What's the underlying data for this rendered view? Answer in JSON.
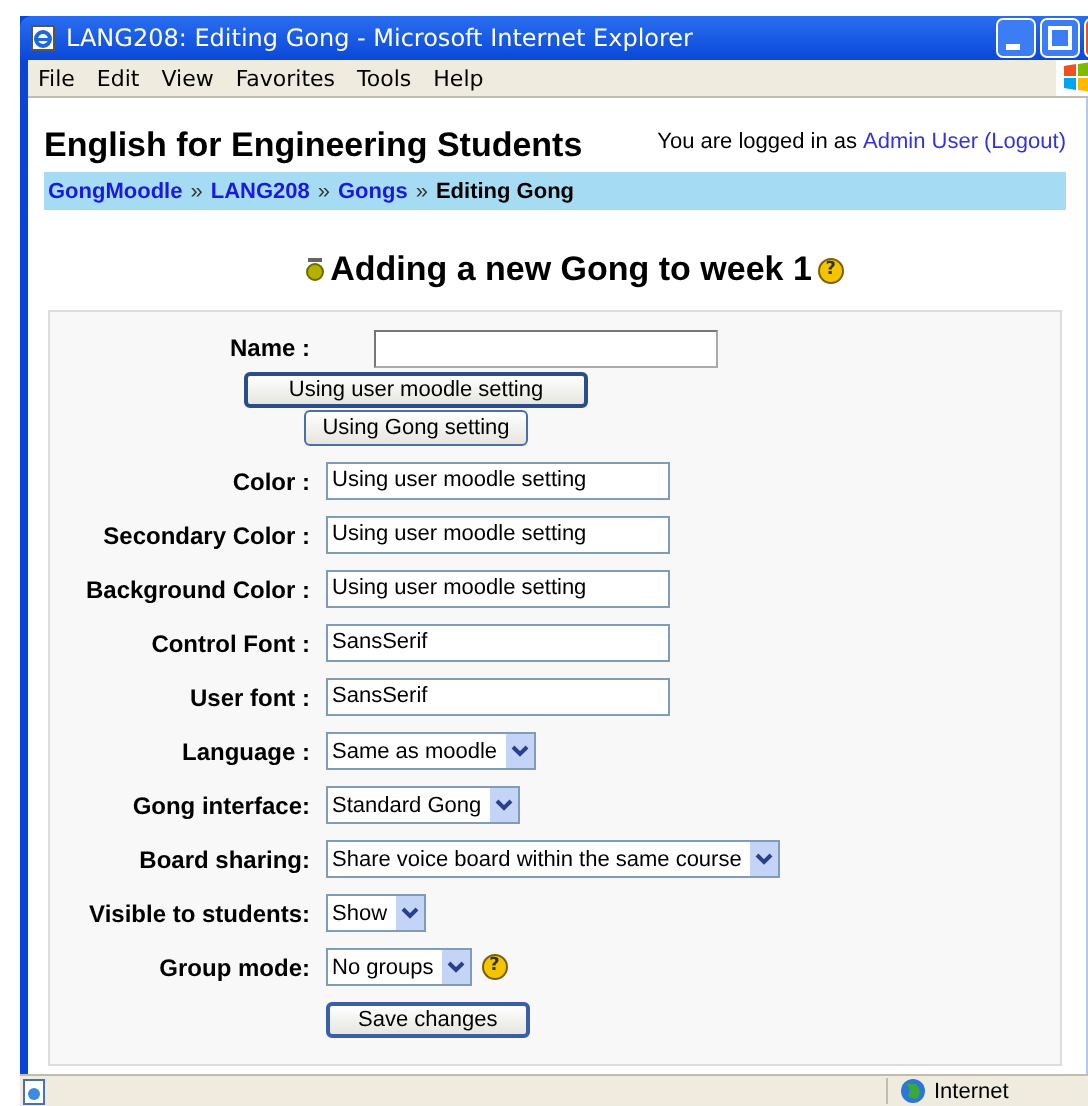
{
  "window": {
    "title": "LANG208: Editing Gong - Microsoft Internet Explorer"
  },
  "menu": [
    {
      "label": "File"
    },
    {
      "label": "Edit"
    },
    {
      "label": "View"
    },
    {
      "label": "Favorites"
    },
    {
      "label": "Tools"
    },
    {
      "label": "Help"
    }
  ],
  "header": {
    "site_title": "English for Engineering Students",
    "login_prefix": "You are logged in as",
    "user": "Admin User",
    "logout": "(Logout)"
  },
  "breadcrumb": {
    "separator": "»",
    "items": [
      {
        "label": "GongMoodle",
        "link": true
      },
      {
        "label": "LANG208",
        "link": true
      },
      {
        "label": "Gongs",
        "link": true
      },
      {
        "label": "Editing Gong",
        "link": false
      }
    ]
  },
  "heading": {
    "text": "Adding a new Gong to week 1",
    "help": "?"
  },
  "form": {
    "rows": [
      {
        "kind": "input",
        "label": "Name :"
      },
      {
        "kind": "buttons",
        "buttons": [
          {
            "label": "Using user moodle setting",
            "focused": true
          },
          {
            "label": "Using Gong setting",
            "focused": false
          }
        ]
      },
      {
        "kind": "text",
        "label": "Color :",
        "value": "Using user moodle setting"
      },
      {
        "kind": "text",
        "label": "Secondary Color :",
        "value": "Using user moodle setting"
      },
      {
        "kind": "text",
        "label": "Background Color :",
        "value": "Using user moodle setting"
      },
      {
        "kind": "text",
        "label": "Control Font :",
        "value": "SansSerif"
      },
      {
        "kind": "text",
        "label": "User font :",
        "value": "SansSerif"
      },
      {
        "kind": "select",
        "label": "Language :",
        "value": "Same as moodle"
      },
      {
        "kind": "select",
        "label": "Gong interface:",
        "value": "Standard Gong"
      },
      {
        "kind": "select",
        "label": "Board sharing:",
        "value": "Share voice board within the same course"
      },
      {
        "kind": "select",
        "label": "Visible to students:",
        "value": "Show"
      },
      {
        "kind": "select",
        "label": "Group mode:",
        "value": "No groups",
        "help": "?"
      }
    ],
    "submit": "Save changes"
  },
  "status_bar": {
    "zone": "Internet"
  }
}
